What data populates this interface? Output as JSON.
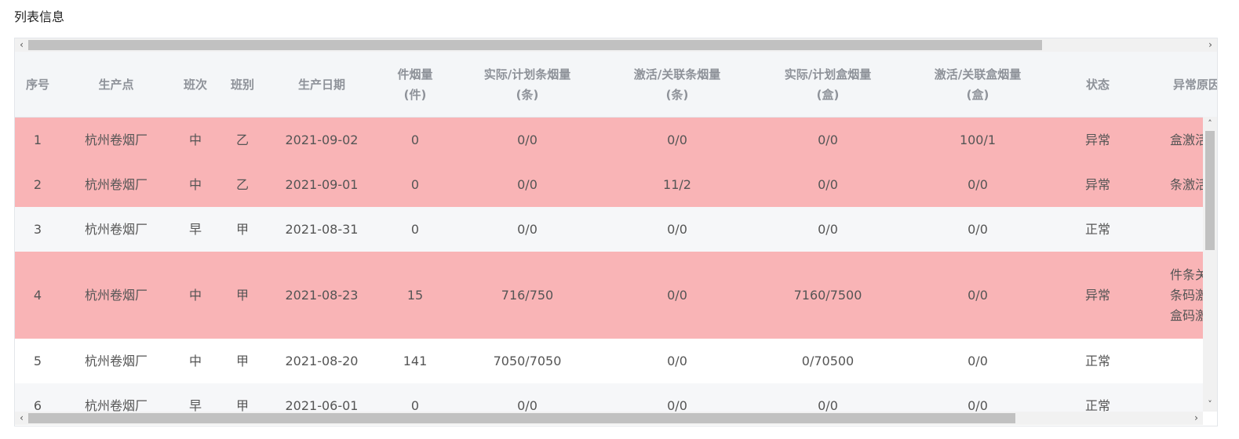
{
  "section_title": "列表信息",
  "table": {
    "headers": [
      {
        "key": "seq",
        "label": "序号"
      },
      {
        "key": "site",
        "label": "生产点"
      },
      {
        "key": "shift",
        "label": "班次"
      },
      {
        "key": "team",
        "label": "班别"
      },
      {
        "key": "date",
        "label": "生产日期"
      },
      {
        "key": "cases",
        "label": "件烟量\n(件)"
      },
      {
        "key": "carton_actual_plan",
        "label": "实际/计划条烟量\n(条)"
      },
      {
        "key": "carton_active_linked",
        "label": "激活/关联条烟量\n(条)"
      },
      {
        "key": "pack_actual_plan",
        "label": "实际/计划盒烟量\n(盒)"
      },
      {
        "key": "pack_active_linked",
        "label": "激活/关联盒烟量\n(盒)"
      },
      {
        "key": "status",
        "label": "状态"
      },
      {
        "key": "reason",
        "label": "异常原因"
      }
    ],
    "rows": [
      {
        "seq": "1",
        "site": "杭州卷烟厂",
        "shift": "中",
        "team": "乙",
        "date": "2021-09-02",
        "cases": "0",
        "carton_actual_plan": "0/0",
        "carton_active_linked": "0/0",
        "pack_actual_plan": "0/0",
        "pack_active_linked": "100/1",
        "status": "异常",
        "reason": "盒激活码",
        "state": "abnormal"
      },
      {
        "seq": "2",
        "site": "杭州卷烟厂",
        "shift": "中",
        "team": "乙",
        "date": "2021-09-01",
        "cases": "0",
        "carton_actual_plan": "0/0",
        "carton_active_linked": "11/2",
        "pack_actual_plan": "0/0",
        "pack_active_linked": "0/0",
        "status": "异常",
        "reason": "条激活码",
        "state": "abnormal"
      },
      {
        "seq": "3",
        "site": "杭州卷烟厂",
        "shift": "早",
        "team": "甲",
        "date": "2021-08-31",
        "cases": "0",
        "carton_actual_plan": "0/0",
        "carton_active_linked": "0/0",
        "pack_actual_plan": "0/0",
        "pack_active_linked": "0/0",
        "status": "正常",
        "reason": "",
        "state": "alt"
      },
      {
        "seq": "4",
        "site": "杭州卷烟厂",
        "shift": "中",
        "team": "甲",
        "date": "2021-08-23",
        "cases": "15",
        "carton_actual_plan": "716/750",
        "carton_active_linked": "0/0",
        "pack_actual_plan": "7160/7500",
        "pack_active_linked": "0/0",
        "status": "异常",
        "reason": "件条关联\n条码激活\n盒码激活",
        "state": "abnormal"
      },
      {
        "seq": "5",
        "site": "杭州卷烟厂",
        "shift": "中",
        "team": "甲",
        "date": "2021-08-20",
        "cases": "141",
        "carton_actual_plan": "7050/7050",
        "carton_active_linked": "0/0",
        "pack_actual_plan": "0/70500",
        "pack_active_linked": "0/0",
        "status": "正常",
        "reason": "",
        "state": "plain"
      },
      {
        "seq": "6",
        "site": "杭州卷烟厂",
        "shift": "早",
        "team": "甲",
        "date": "2021-06-01",
        "cases": "0",
        "carton_actual_plan": "0/0",
        "carton_active_linked": "0/0",
        "pack_actual_plan": "0/0",
        "pack_active_linked": "0/0",
        "status": "正常",
        "reason": "",
        "state": "alt"
      }
    ]
  },
  "scrollbars": {
    "horizontal_left_icon": "chevron-left-icon",
    "horizontal_right_icon": "chevron-right-icon",
    "vertical_up_icon": "chevron-up-icon",
    "vertical_down_icon": "chevron-down-icon"
  },
  "colors": {
    "abnormal_row": "#f9b4b6",
    "header_bg": "#f4f6f8",
    "header_text": "#8e9299"
  }
}
